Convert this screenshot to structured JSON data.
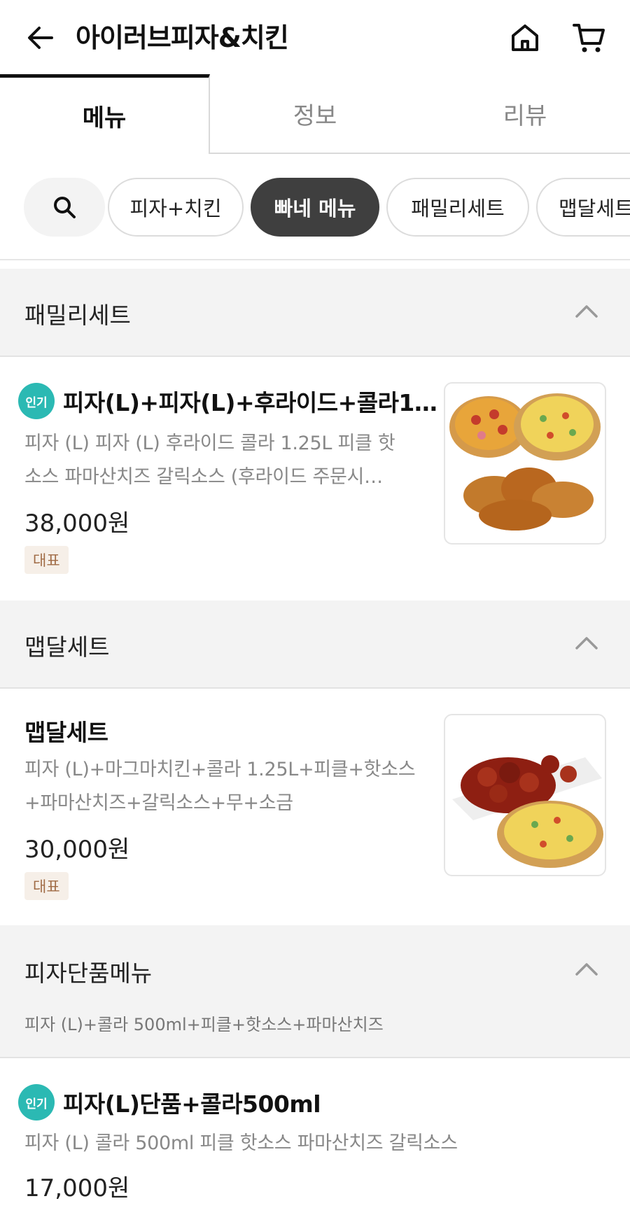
{
  "header": {
    "title": "아이러브피자&치킨",
    "back_icon": "back-arrow-icon",
    "home_icon": "home-icon",
    "cart_icon": "cart-icon"
  },
  "tabs": [
    {
      "label": "메뉴",
      "active": true
    },
    {
      "label": "정보",
      "active": false
    },
    {
      "label": "리뷰",
      "active": false
    }
  ],
  "chips": {
    "search_icon": "search-icon",
    "items": [
      {
        "label": "피자+치킨",
        "active": false
      },
      {
        "label": "빠네 메뉴",
        "active": true
      },
      {
        "label": "패밀리세트",
        "active": false
      },
      {
        "label": "맵달세트",
        "active": false
      }
    ]
  },
  "sections": [
    {
      "title": "패밀리세트",
      "items": [
        {
          "hot_badge": "인기",
          "name": "피자(L)+피자(L)+후라이드+콜라1…",
          "desc_line1": "피자 (L) 피자 (L) 후라이드 콜라 1.25L 피클 핫",
          "desc_line2": "소스 파마산치즈 갈릭소스 (후라이드 주문시…",
          "price": "38,000원",
          "tag": "대표"
        }
      ]
    },
    {
      "title": "맵달세트",
      "items": [
        {
          "name": "맵달세트",
          "desc_line1": "피자 (L)+마그마치킨+콜라 1.25L+피클+핫소스",
          "desc_line2": "+파마산치즈+갈릭소스+무+소금",
          "price": "30,000원",
          "tag": "대표"
        }
      ]
    },
    {
      "title": "피자단품메뉴",
      "desc": "피자 (L)+콜라 500ml+피클+핫소스+파마산치즈",
      "items": [
        {
          "hot_badge": "인기",
          "name": "피자(L)단품+콜라500ml",
          "desc_line1": "피자 (L) 콜라 500ml 피클 핫소스 파마산치즈 갈릭소스",
          "price": "17,000원"
        }
      ]
    }
  ],
  "colors": {
    "accent_teal": "#2bb9b3",
    "chip_active": "#3f3f3f",
    "tag_bg": "#f6efe8",
    "tag_text": "#a06b45",
    "section_bg": "#f3f3f3"
  }
}
